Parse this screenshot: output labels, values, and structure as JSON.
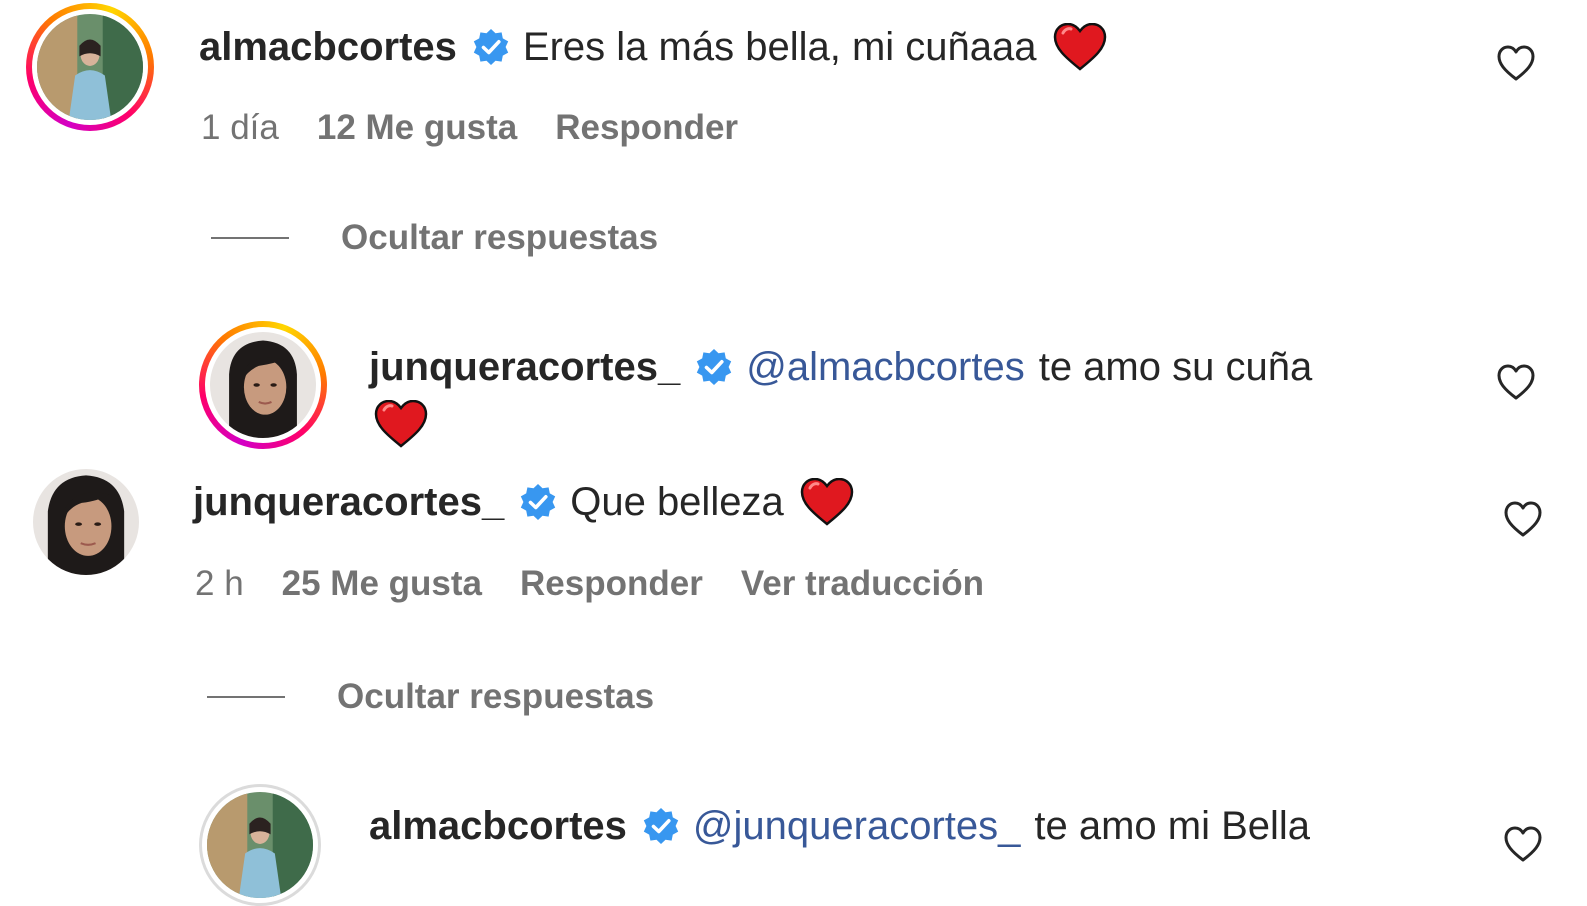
{
  "comments": [
    {
      "username": "almacbcortes",
      "text": "Eres la más bella, mi cuñaaa",
      "time": "1 día",
      "likes": "12 Me gusta",
      "reply": "Responder",
      "replies_toggle": "Ocultar respuestas",
      "replies": [
        {
          "username": "junqueracortes_",
          "mention": "@almacbcortes",
          "text": "te amo su cuña"
        }
      ]
    },
    {
      "username": "junqueracortes_",
      "text": "Que belleza",
      "time": "2 h",
      "likes": "25 Me gusta",
      "reply": "Responder",
      "translate": "Ver traducción",
      "replies_toggle": "Ocultar respuestas",
      "replies": [
        {
          "username": "almacbcortes",
          "mention": "@junqueracortes_",
          "text": "te amo mi Bella"
        }
      ]
    }
  ],
  "icons": {
    "verified": "verified-badge-icon",
    "emoji": "red-heart-emoji",
    "like": "heart-outline-icon"
  },
  "colors": {
    "text": "#262626",
    "secondary": "#737373",
    "mention": "#385898",
    "verified": "#3897f0",
    "emoji_heart": "#e0181f"
  }
}
